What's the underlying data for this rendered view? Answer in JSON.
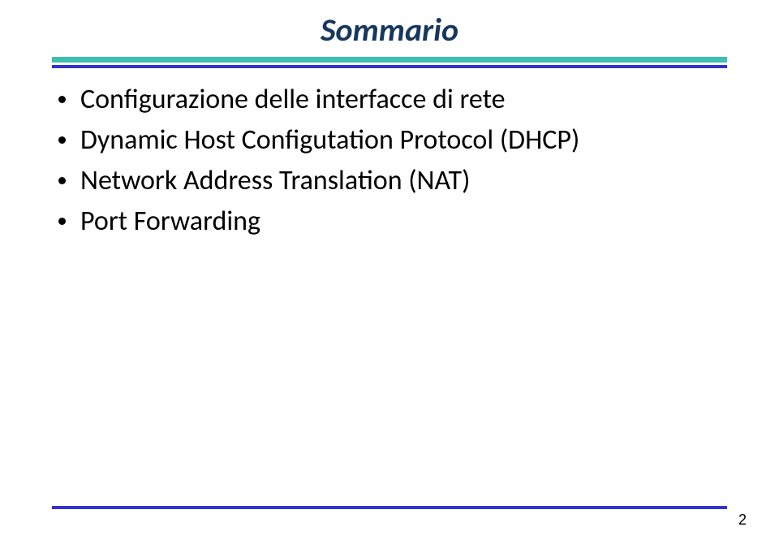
{
  "title": "Sommario",
  "bullets": [
    "Configurazione delle interfacce di rete",
    "Dynamic Host Configutation Protocol (DHCP)",
    "Network Address Translation (NAT)",
    "Port Forwarding"
  ],
  "page_number": "2"
}
